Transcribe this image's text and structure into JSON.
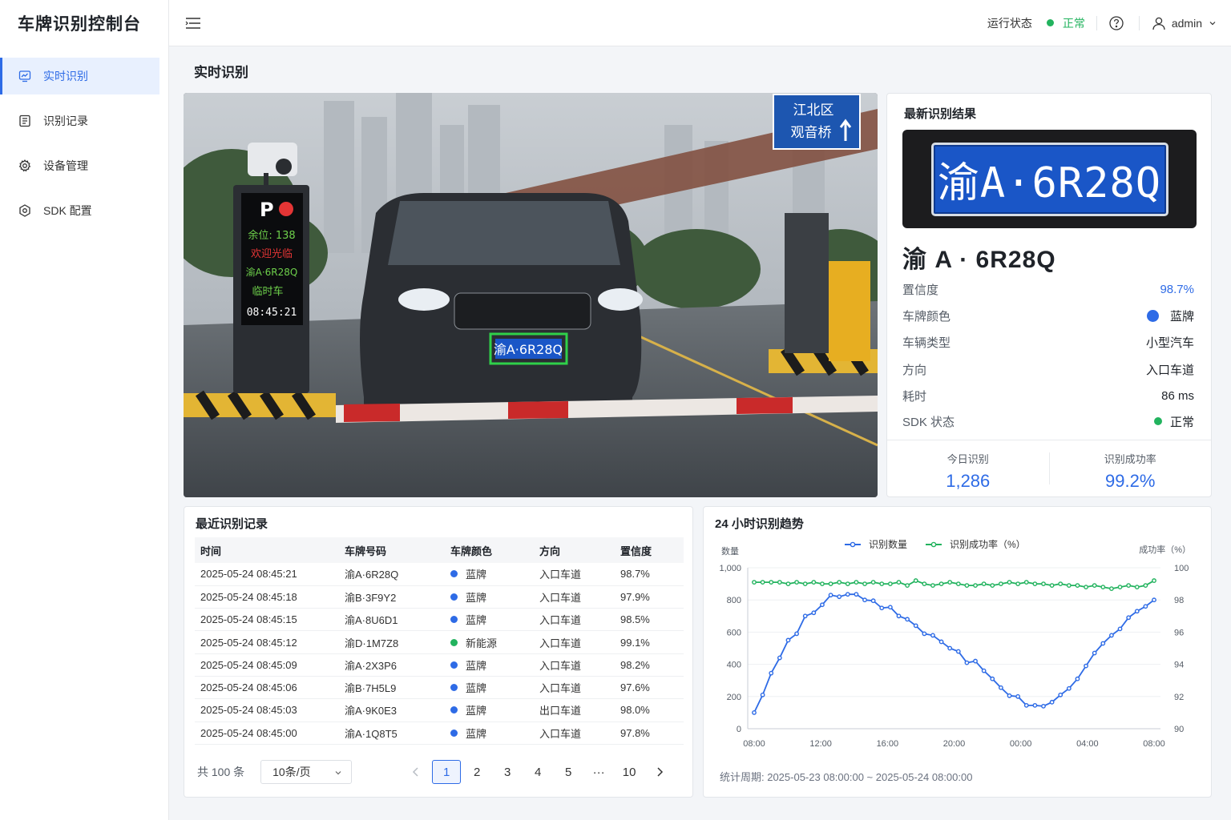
{
  "app": {
    "title": "车牌识别控制台"
  },
  "sidebar": {
    "items": [
      {
        "label": "实时识别",
        "icon": "monitor-icon",
        "active": true
      },
      {
        "label": "识别记录",
        "icon": "list-icon",
        "active": false
      },
      {
        "label": "设备管理",
        "icon": "gear-icon",
        "active": false
      },
      {
        "label": "SDK 配置",
        "icon": "hexagon-gear-icon",
        "active": false
      }
    ]
  },
  "header": {
    "status_label": "运行状态",
    "status_value": "正常",
    "status_color": "#22b35e",
    "user": "admin"
  },
  "page": {
    "title": "实时识别"
  },
  "camera": {
    "sign_top": "江北区",
    "sign_bottom": "观音桥",
    "display_p": "P",
    "display_spaces": "余位: 138",
    "display_welcome": "欢迎光临",
    "display_plate": "渝A·6R28Q",
    "display_type": "临时车",
    "display_time": "08:45:21",
    "detected_plate": "渝A·6R28Q"
  },
  "result": {
    "title": "最新识别结果",
    "plate_image_text": "渝A·6R28Q",
    "plate": "渝 A · 6R28Q",
    "fields": {
      "confidence_label": "置信度",
      "confidence": "98.7%",
      "color_label": "车牌颜色",
      "color": "蓝牌",
      "type_label": "车辆类型",
      "type": "小型汽车",
      "direction_label": "方向",
      "direction": "入口车道",
      "latency_label": "耗时",
      "latency": "86 ms",
      "sdk_label": "SDK 状态",
      "sdk": "正常"
    },
    "today_label": "今日识别",
    "today_value": "1,286",
    "rate_label": "识别成功率",
    "rate_value": "99.2%"
  },
  "records": {
    "title": "最近识别记录",
    "columns": [
      "时间",
      "车牌号码",
      "车牌颜色",
      "方向",
      "置信度"
    ],
    "rows": [
      {
        "time": "2025-05-24 08:45:21",
        "plate": "渝A·6R28Q",
        "color": "蓝牌",
        "dot": "#2e6be6",
        "dir": "入口车道",
        "conf": "98.7%"
      },
      {
        "time": "2025-05-24 08:45:18",
        "plate": "渝B·3F9Y2",
        "color": "蓝牌",
        "dot": "#2e6be6",
        "dir": "入口车道",
        "conf": "97.9%"
      },
      {
        "time": "2025-05-24 08:45:15",
        "plate": "渝A·8U6D1",
        "color": "蓝牌",
        "dot": "#2e6be6",
        "dir": "入口车道",
        "conf": "98.5%"
      },
      {
        "time": "2025-05-24 08:45:12",
        "plate": "渝D·1M7Z8",
        "color": "新能源",
        "dot": "#22b35e",
        "dir": "入口车道",
        "conf": "99.1%"
      },
      {
        "time": "2025-05-24 08:45:09",
        "plate": "渝A·2X3P6",
        "color": "蓝牌",
        "dot": "#2e6be6",
        "dir": "入口车道",
        "conf": "98.2%"
      },
      {
        "time": "2025-05-24 08:45:06",
        "plate": "渝B·7H5L9",
        "color": "蓝牌",
        "dot": "#2e6be6",
        "dir": "入口车道",
        "conf": "97.6%"
      },
      {
        "time": "2025-05-24 08:45:03",
        "plate": "渝A·9K0E3",
        "color": "蓝牌",
        "dot": "#2e6be6",
        "dir": "出口车道",
        "conf": "98.0%"
      },
      {
        "time": "2025-05-24 08:45:00",
        "plate": "渝A·1Q8T5",
        "color": "蓝牌",
        "dot": "#2e6be6",
        "dir": "入口车道",
        "conf": "97.8%"
      }
    ],
    "total": "共 100 条",
    "page_size": "10条/页",
    "pages": [
      "1",
      "2",
      "3",
      "4",
      "5",
      "···",
      "10"
    ],
    "current_page": "1"
  },
  "trend": {
    "title": "24 小时识别趋势",
    "footer": "统计周期:  2025-05-23 08:00:00 ~ 2025-05-24 08:00:00"
  },
  "chart_data": {
    "type": "line",
    "title": "24 小时识别趋势",
    "ylabel": "数量",
    "y2label": "成功率（%）",
    "ylim": [
      0,
      1000
    ],
    "y2lim": [
      90,
      100
    ],
    "yticks": [
      "0",
      "200",
      "400",
      "600",
      "800",
      "1,000"
    ],
    "y2ticks": [
      "90",
      "92",
      "94",
      "96",
      "98",
      "100"
    ],
    "xticks": [
      "08:00",
      "12:00",
      "16:00",
      "20:00",
      "00:00",
      "04:00",
      "08:00"
    ],
    "grid": true,
    "legend_position": "top",
    "series": [
      {
        "name": "识别数量",
        "axis": "left",
        "color": "#2e6be6",
        "values": [
          100,
          210,
          345,
          440,
          550,
          590,
          700,
          720,
          770,
          830,
          820,
          835,
          835,
          800,
          795,
          750,
          755,
          700,
          680,
          640,
          590,
          580,
          540,
          500,
          480,
          410,
          420,
          360,
          310,
          255,
          205,
          200,
          145,
          145,
          140,
          165,
          210,
          250,
          310,
          390,
          470,
          530,
          580,
          620,
          690,
          730,
          760,
          800
        ]
      },
      {
        "name": "识别成功率（%）",
        "axis": "right",
        "color": "#22b35e",
        "values": [
          99.1,
          99.1,
          99.1,
          99.1,
          99.0,
          99.1,
          99.0,
          99.1,
          99.0,
          99.0,
          99.1,
          99.0,
          99.1,
          99.0,
          99.1,
          99.0,
          99.0,
          99.1,
          98.9,
          99.2,
          99.0,
          98.9,
          99.0,
          99.1,
          99.0,
          98.9,
          98.9,
          99.0,
          98.9,
          99.0,
          99.1,
          99.0,
          99.1,
          99.0,
          99.0,
          98.9,
          99.0,
          98.9,
          98.9,
          98.8,
          98.9,
          98.8,
          98.7,
          98.8,
          98.9,
          98.8,
          98.9,
          99.2
        ]
      }
    ]
  }
}
